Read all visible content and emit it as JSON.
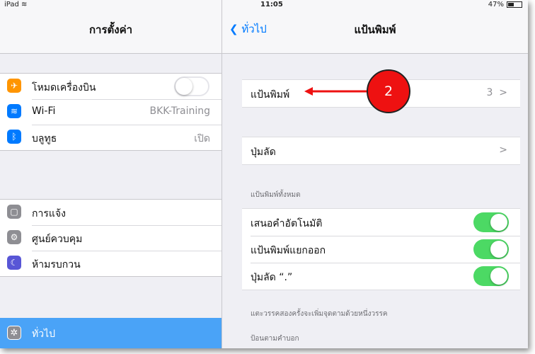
{
  "status": {
    "device": "iPad",
    "wifi": "wifi-icon",
    "time": "11:05",
    "battery": "47%",
    "battery_level": 0.47
  },
  "master": {
    "title": "การตั้งค่า",
    "group1": [
      {
        "label": "โหมดเครื่องบิน",
        "icon": "airplane-icon",
        "color": "#ff9500",
        "toggle": false
      },
      {
        "label": "Wi-Fi",
        "value": "BKK-Training",
        "icon": "wifi-icon",
        "color": "#007aff"
      },
      {
        "label": "บลูทูธ",
        "value": "เปิด",
        "icon": "bluetooth-icon",
        "color": "#007aff"
      }
    ],
    "group2": [
      {
        "label": "การแจ้ง",
        "icon": "notifications-icon",
        "color": "#8e8e93"
      },
      {
        "label": "ศูนย์ควบคุม",
        "icon": "control-center-icon",
        "color": "#8e8e93"
      },
      {
        "label": "ห้ามรบกวน",
        "icon": "moon-icon",
        "color": "#5856d6"
      }
    ],
    "selected": {
      "label": "ทั่วไป",
      "icon": "gear-icon"
    }
  },
  "detail": {
    "back_label": "ทั่วไป",
    "title": "แป้นพิมพ์",
    "keyboards": {
      "label": "แป้นพิมพ์",
      "value": "3",
      "chevron": ">"
    },
    "shortcuts": {
      "label": "ปุ่มลัด",
      "chevron": ">"
    },
    "section_all": "แป้นพิมพ์ทั้งหมด",
    "toggles": [
      {
        "label": "เสนอคำอัตโนมัติ",
        "on": true
      },
      {
        "label": "แป้นพิมพ์แยกออก",
        "on": true
      },
      {
        "label": "ปุ่มลัด “.”",
        "on": true
      }
    ],
    "footnote": "แตะวรรคสองครั้งจะเพิ่มจุดตามด้วยหนึ่งวรรค",
    "section_dictation": "ป้อนตามคำบอก"
  },
  "annotation": {
    "step": "2",
    "color": "#ee1111"
  }
}
